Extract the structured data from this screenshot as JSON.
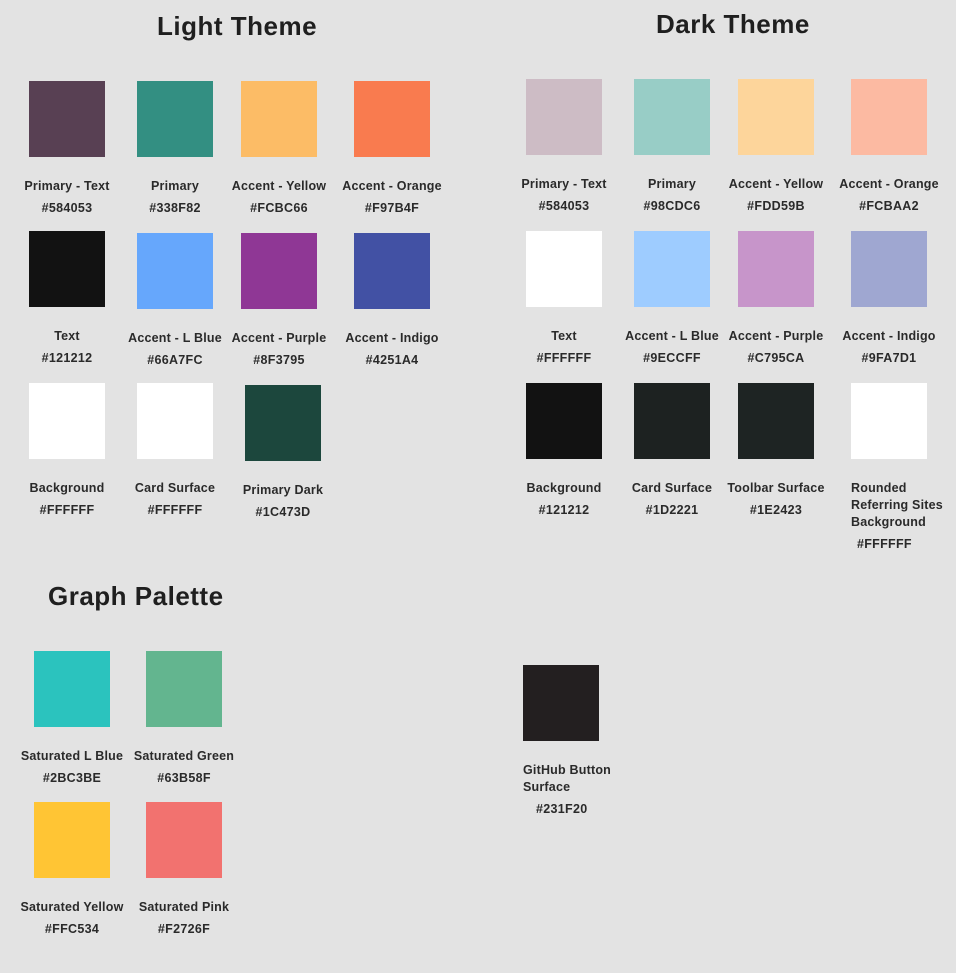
{
  "sections": {
    "light": "Light Theme",
    "dark": "Dark Theme",
    "graph": "Graph Palette"
  },
  "swatches": [
    {
      "label": "Primary - Text",
      "hex": "#584053",
      "color": "#584053"
    },
    {
      "label": "Primary",
      "hex": "#338F82",
      "color": "#338F82"
    },
    {
      "label": "Accent - Yellow",
      "hex": "#FCBC66",
      "color": "#FCBC66"
    },
    {
      "label": "Accent - Orange",
      "hex": "#F97B4F",
      "color": "#F97B4F"
    },
    {
      "label": "Text",
      "hex": "#121212",
      "color": "#121212"
    },
    {
      "label": "Accent - L Blue",
      "hex": "#66A7FC",
      "color": "#66A7FC"
    },
    {
      "label": "Accent - Purple",
      "hex": "#8F3795",
      "color": "#8F3795"
    },
    {
      "label": "Accent - Indigo",
      "hex": "#4251A4",
      "color": "#4251A4"
    },
    {
      "label": "Background",
      "hex": "#FFFFFF",
      "color": "#FFFFFF"
    },
    {
      "label": "Card Surface",
      "hex": "#FFFFFF",
      "color": "#FFFFFF"
    },
    {
      "label": "Primary Dark",
      "hex": "#1C473D",
      "color": "#1C473D"
    },
    {
      "label": "Primary - Text",
      "hex": "#584053",
      "color": "#CDBCC5"
    },
    {
      "label": "Primary",
      "hex": "#98CDC6",
      "color": "#98CDC6"
    },
    {
      "label": "Accent - Yellow",
      "hex": "#FDD59B",
      "color": "#FDD59B"
    },
    {
      "label": "Accent - Orange",
      "hex": "#FCBAA2",
      "color": "#FCBAA2"
    },
    {
      "label": "Text",
      "hex": "#FFFFFF",
      "color": "#FFFFFF"
    },
    {
      "label": "Accent - L Blue",
      "hex": "#9ECCFF",
      "color": "#9ECCFF"
    },
    {
      "label": "Accent - Purple",
      "hex": "#C795CA",
      "color": "#C795CA"
    },
    {
      "label": "Accent - Indigo",
      "hex": "#9FA7D1",
      "color": "#9FA7D1"
    },
    {
      "label": "Background",
      "hex": "#121212",
      "color": "#121212"
    },
    {
      "label": "Card Surface",
      "hex": "#1D2221",
      "color": "#1D2221"
    },
    {
      "label": "Toolbar Surface",
      "hex": "#1E2423",
      "color": "#1E2423"
    },
    {
      "label": "Rounded Referring Sites Background",
      "hex": "#FFFFFF",
      "color": "#FFFFFF"
    },
    {
      "label": "Saturated L Blue",
      "hex": "#2BC3BE",
      "color": "#2BC3BE"
    },
    {
      "label": "Saturated Green",
      "hex": "#63B58F",
      "color": "#63B58F"
    },
    {
      "label": "Saturated Yellow",
      "hex": "#FFC534",
      "color": "#FFC534"
    },
    {
      "label": "Saturated Pink",
      "hex": "#F2726F",
      "color": "#F2726F"
    },
    {
      "label": "GitHub Button Surface",
      "hex": "#231F20",
      "color": "#231F20"
    }
  ]
}
